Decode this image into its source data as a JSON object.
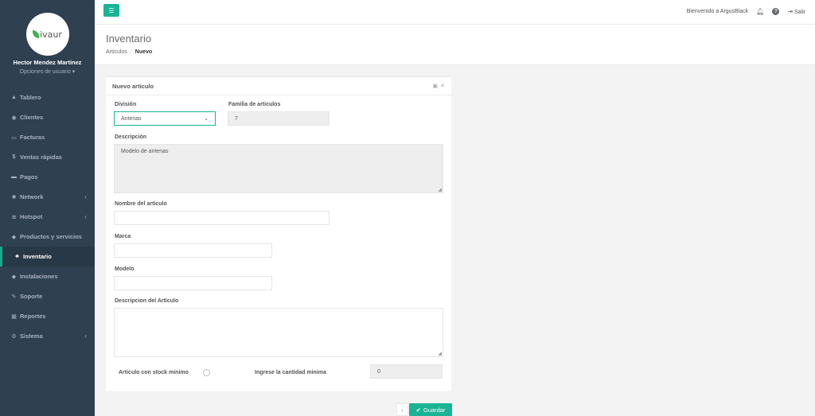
{
  "sidebar": {
    "logo_text": "ivaur",
    "user_name": "Hector Mendez Martínez",
    "user_options": "Opciones de usuario ▾",
    "items": [
      {
        "icon": "▲",
        "label": "Tablero"
      },
      {
        "icon": "◉",
        "label": "Clientes"
      },
      {
        "icon": "▭",
        "label": "Facturas"
      },
      {
        "icon": "$",
        "label": "Ventas rápidas"
      },
      {
        "icon": "▬",
        "label": "Pagos"
      },
      {
        "icon": "✱",
        "label": "Network"
      },
      {
        "icon": "≋",
        "label": "Hotspot"
      },
      {
        "icon": "◆",
        "label": "Productos y servicios"
      },
      {
        "icon": "♣",
        "label": "Inventario"
      },
      {
        "icon": "◆",
        "label": "Instalaciones"
      },
      {
        "icon": "✎",
        "label": "Soporte"
      },
      {
        "icon": "▦",
        "label": "Reportes"
      },
      {
        "icon": "⚙",
        "label": "Sistema"
      }
    ]
  },
  "topbar": {
    "menu_icon": "☰",
    "welcome": "Bienvenido a ArgusBlack",
    "logout": "Salir"
  },
  "heading": {
    "title": "Inventario",
    "crumb_1": "Articulos",
    "crumb_2": "Nuevo"
  },
  "panel": {
    "title": "Nuevo articulo",
    "division_label": "División",
    "division_value": "Antenas",
    "familia_label": "Familia de articulos",
    "familia_value": "7",
    "descripcion_label": "Descripción",
    "descripcion_value": "Modelo de antenas",
    "nombre_label": "Nombre del articulo",
    "marca_label": "Marca",
    "modelo_label": "Modelo",
    "desc_articulo_label": "Descripcion del Articulo",
    "stock_label": "Articulo con stock minimo",
    "cantidad_label": "Ingrese la cantidad minima",
    "cantidad_value": "0"
  },
  "footer": {
    "save_label": "Guardar"
  },
  "colors": {
    "accent": "#1ab394",
    "sidebar_bg": "#2f4050"
  }
}
